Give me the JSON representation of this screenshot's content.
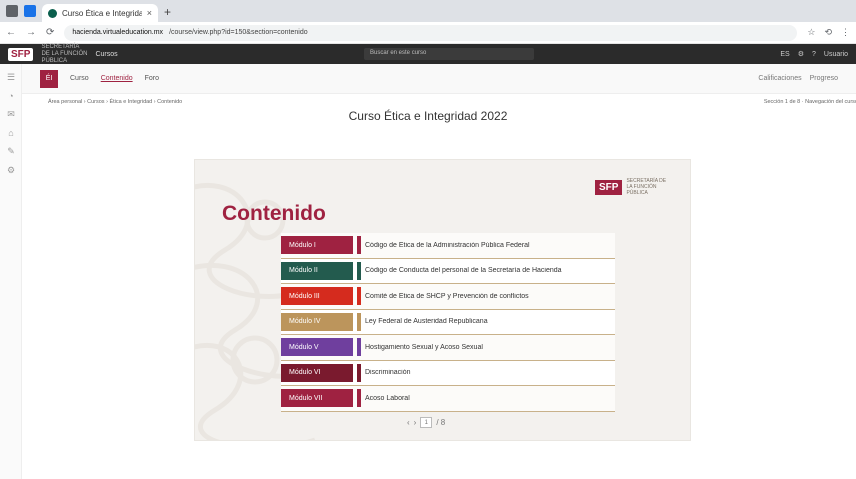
{
  "browser": {
    "tab_title": "Curso Ética e Integridad 2022",
    "tab_close": "×",
    "new_tab": "+",
    "url_host": "hacienda.virtualeducation.mx",
    "url_path": "/course/view.php?id=150&section=contenido",
    "nav_back": "←",
    "nav_forward": "→",
    "nav_reload": "⟳",
    "right_icons": [
      "☆",
      "⟲",
      "⋮"
    ]
  },
  "site_header": {
    "logo": "SFP",
    "subtitle": "SECRETARÍA DE LA FUNCIÓN PÚBLICA",
    "menu": "Cursos",
    "search_placeholder": "Buscar en este curso",
    "right_items": [
      "ES",
      "⚙",
      "?",
      "Usuario"
    ]
  },
  "course_bar": {
    "icon_label": "ÉI",
    "links": [
      "Curso",
      "Contenido",
      "Foro"
    ],
    "right_items": [
      "Calificaciones",
      "Progreso"
    ]
  },
  "breadcrumb": {
    "left": "Área personal › Cursos › Ética e Integridad › Contenido",
    "right": "Sección 1 de 8 · Navegación del curso"
  },
  "page_title": "Curso Ética e Integridad 2022",
  "card": {
    "brand": "SFP",
    "brand_text": "SECRETARÍA DE LA FUNCIÓN PÚBLICA",
    "heading": "Contenido",
    "modules": [
      {
        "label": "Módulo I",
        "color": "#9f2241",
        "desc": "Código de Ética de la Administración Pública Federal"
      },
      {
        "label": "Módulo II",
        "color": "#235b4e",
        "desc": "Código de Conducta del personal de la Secretaría de Hacienda"
      },
      {
        "label": "Módulo III",
        "color": "#d52b1e",
        "desc": "Comité de Ética de SHCP y Prevención de conflictos"
      },
      {
        "label": "Módulo IV",
        "color": "#bc955c",
        "desc": "Ley Federal de Austeridad Republicana"
      },
      {
        "label": "Módulo V",
        "color": "#6f3f9e",
        "desc": "Hostigamiento Sexual y Acoso Sexual"
      },
      {
        "label": "Módulo VI",
        "color": "#7a1a2e",
        "desc": "Discriminación"
      },
      {
        "label": "Módulo VII",
        "color": "#9f2241",
        "desc": "Acoso Laboral"
      }
    ],
    "pager": {
      "prev": "‹",
      "next": "›",
      "page": "1",
      "of": "/ 8"
    }
  },
  "rail_icons": [
    "☰",
    "◔",
    "✉",
    "⌂",
    "✎",
    "⚙"
  ]
}
